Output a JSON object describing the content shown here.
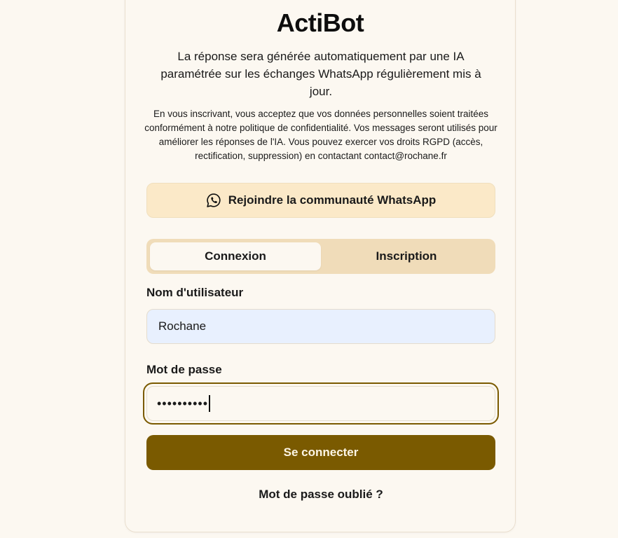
{
  "app": {
    "title": "ActiBot",
    "subtitle": "La réponse sera générée automatiquement par une IA paramétrée sur les échanges WhatsApp régulièrement mis à jour.",
    "privacy_notice": "En vous inscrivant, vous acceptez que vos données personnelles soient traitées conformément à notre politique de confidentialité. Vos messages seront utilisés pour améliorer les réponses de l'IA. Vous pouvez exercer vos droits RGPD (accès, rectification, suppression) en contactant contact@rochane.fr"
  },
  "whatsapp": {
    "label": "Rejoindre la communauté WhatsApp",
    "icon": "whatsapp-icon"
  },
  "tabs": [
    {
      "label": "Connexion",
      "active": true
    },
    {
      "label": "Inscription",
      "active": false
    }
  ],
  "form": {
    "username_label": "Nom d'utilisateur",
    "username_value": "Rochane",
    "password_label": "Mot de passe",
    "password_masked": "••••••••••",
    "submit_label": "Se connecter",
    "forgot_label": "Mot de passe oublié ?"
  },
  "colors": {
    "background": "#fcf8f1",
    "accent": "#7a5a00",
    "whatsapp_button_bg": "#fbe9c8",
    "tabs_bg": "#f0dcb9",
    "autofill_bg": "#e8f0fe"
  }
}
